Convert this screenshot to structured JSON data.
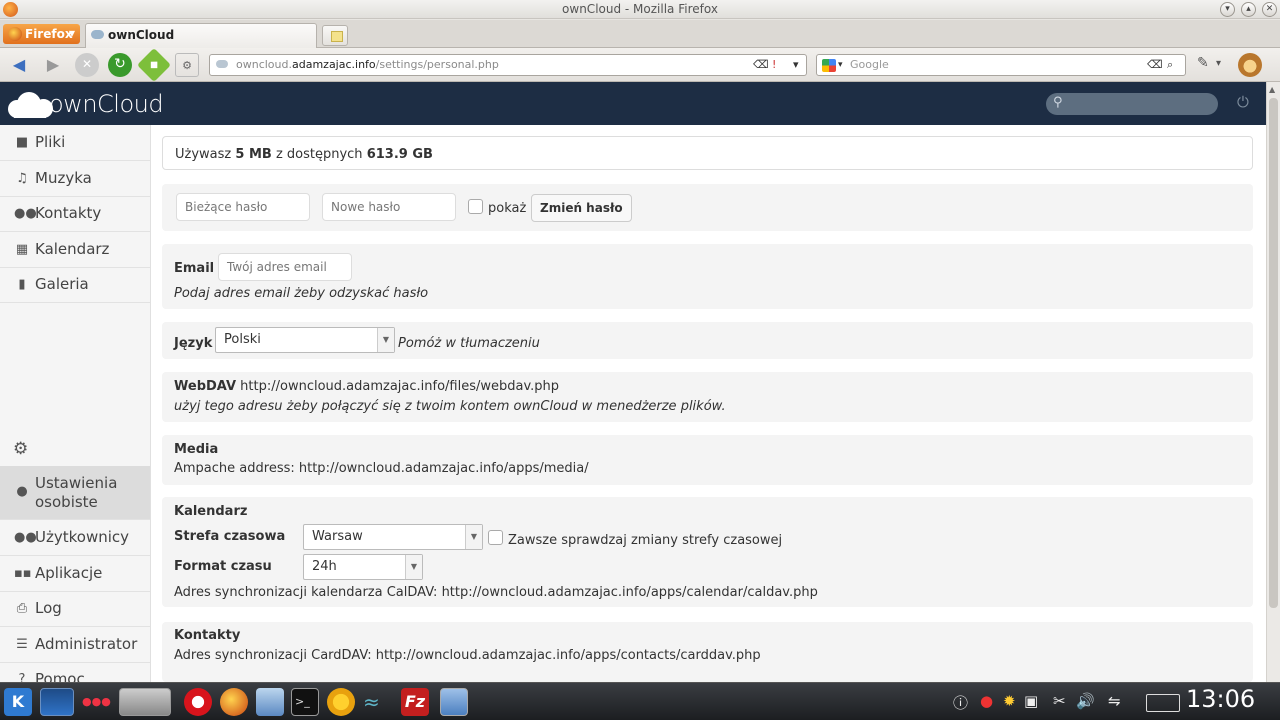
{
  "window": {
    "title": "ownCloud - Mozilla Firefox"
  },
  "browser": {
    "menu_button": "Firefox",
    "tab_title": "ownCloud",
    "url_prefix": "owncloud.",
    "url_domain": "adamzajac.info",
    "url_path": "/settings/personal.php",
    "search_placeholder": "Google"
  },
  "header": {
    "brand_prefix": "own",
    "brand_suffix": "Cloud"
  },
  "sidebar": {
    "items": [
      {
        "label": "Pliki",
        "icon": "folder-icon"
      },
      {
        "label": "Muzyka",
        "icon": "music-icon"
      },
      {
        "label": "Kontakty",
        "icon": "contacts-icon"
      },
      {
        "label": "Kalendarz",
        "icon": "calendar-icon"
      },
      {
        "label": "Galeria",
        "icon": "gallery-icon"
      }
    ],
    "settings_items": [
      {
        "label": "Ustawienia osobiste",
        "icon": "user-icon",
        "active": true
      },
      {
        "label": "Użytkownicy",
        "icon": "users-icon"
      },
      {
        "label": "Aplikacje",
        "icon": "apps-icon"
      },
      {
        "label": "Log",
        "icon": "log-icon"
      },
      {
        "label": "Administrator",
        "icon": "admin-icon"
      },
      {
        "label": "Pomoc",
        "icon": "help-icon"
      }
    ]
  },
  "quota": {
    "prefix": "Używasz",
    "used": "5 MB",
    "middle": "z dostępnych",
    "total": "613.9 GB"
  },
  "password": {
    "current_placeholder": "Bieżące hasło",
    "new_placeholder": "Nowe hasło",
    "show_label": "pokaż",
    "change_button": "Zmień hasło"
  },
  "email": {
    "label": "Email",
    "placeholder": "Twój adres email",
    "hint": "Podaj adres email żeby odzyskać hasło"
  },
  "language": {
    "label": "Język",
    "selected": "Polski",
    "help_link": "Pomóż w tłumaczeniu"
  },
  "webdav": {
    "label": "WebDAV",
    "url": "http://owncloud.adamzajac.info/files/webdav.php",
    "hint": "użyj tego adresu żeby połączyć się z twoim kontem ownCloud w menedżerze plików."
  },
  "media": {
    "title": "Media",
    "text": "Ampache address: http://owncloud.adamzajac.info/apps/media/"
  },
  "calendar": {
    "title": "Kalendarz",
    "timezone_label": "Strefa czasowa",
    "timezone": "Warsaw",
    "timezone_check_label": "Zawsze sprawdzaj zmiany strefy czasowej",
    "timeformat_label": "Format czasu",
    "timeformat": "24h",
    "caldav": "Adres synchronizacji kalendarza CalDAV: http://owncloud.adamzajac.info/apps/calendar/caldav.php"
  },
  "contacts": {
    "title": "Kontakty",
    "carddav": "Adres synchronizacji CardDAV: http://owncloud.adamzajac.info/apps/contacts/carddav.php"
  },
  "taskbar": {
    "clock": "13:06"
  }
}
